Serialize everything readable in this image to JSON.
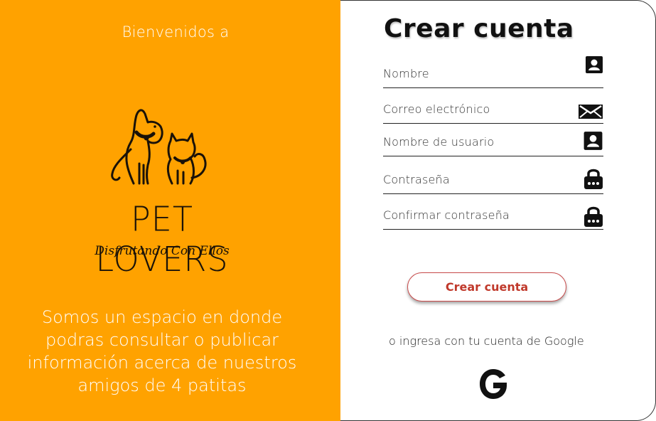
{
  "left": {
    "welcome": "Bienvenidos a",
    "logo_title": "PET LOVERS",
    "logo_subtitle": "Disfrutando Con Ellos",
    "description": "Somos un espacio en donde podras consultar o publicar información acerca de nuestros amigos de 4 patitas"
  },
  "form": {
    "title": "Crear cuenta",
    "fields": [
      {
        "label": "Nombre",
        "icon": "user-card-icon"
      },
      {
        "label": "Correo electrónico",
        "icon": "envelope-icon"
      },
      {
        "label": "Nombre de usuario",
        "icon": "user-card-icon"
      },
      {
        "label": "Contraseña",
        "icon": "lock-icon"
      },
      {
        "label": "Confirmar contraseña",
        "icon": "lock-icon"
      }
    ],
    "submit_label": "Crear cuenta",
    "google_text": "o ingresa con tu cuenta de Google",
    "google_icon": "google-g-icon"
  },
  "colors": {
    "left_panel_bg": "#ffa200",
    "button_accent": "#c0392b",
    "text_dark": "#111111"
  }
}
